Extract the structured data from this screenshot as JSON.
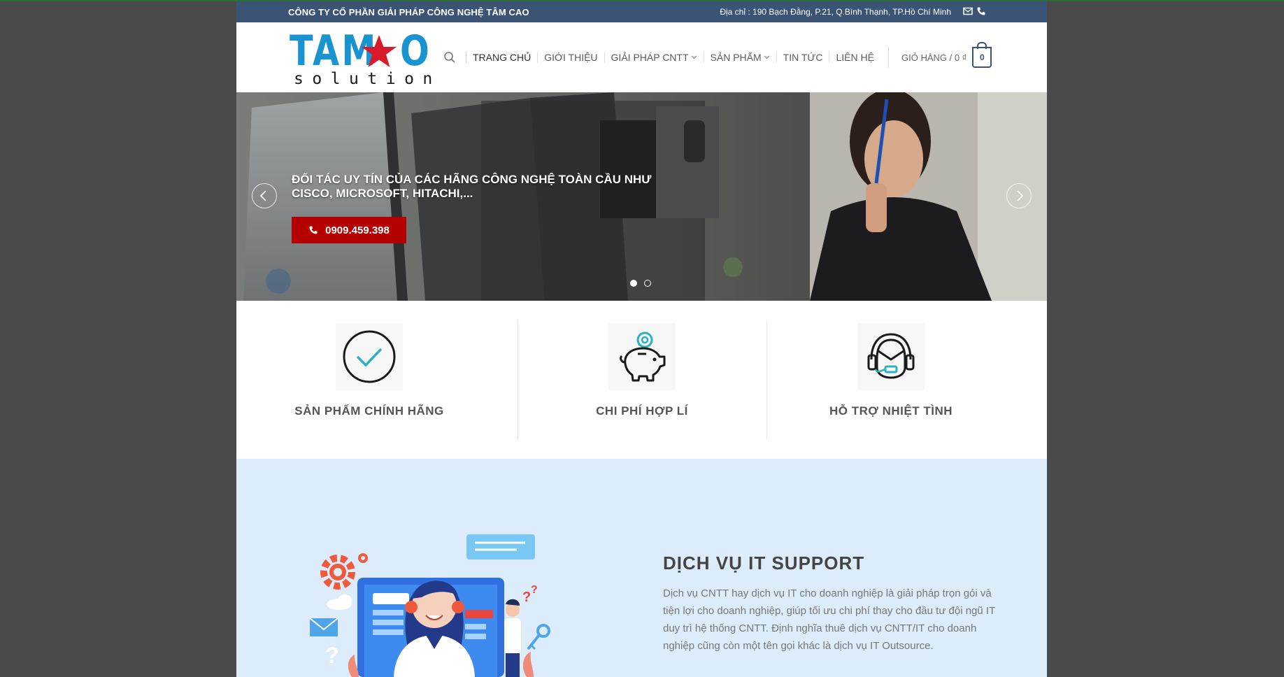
{
  "topbar": {
    "company": "CÔNG TY CỔ PHẦN GIẢI PHÁP CÔNG NGHỆ TÂM CAO",
    "address": "Địa chỉ : 190 Bạch Đằng, P.21, Q.Bình Thạnh, TP.Hồ Chí Minh"
  },
  "logo": {
    "line1_left": "TAM",
    "line1_right": "O",
    "line2": "solution"
  },
  "nav": {
    "items": [
      {
        "label": "TRANG CHỦ"
      },
      {
        "label": "GIỚI THIỆU"
      },
      {
        "label": "GIẢI PHÁP CNTT"
      },
      {
        "label": "SẢN PHẨM"
      },
      {
        "label": "TIN TỨC"
      },
      {
        "label": "LIÊN HỆ"
      }
    ]
  },
  "cart": {
    "label": "GIỎ HÀNG / 0 ₫",
    "count": "0"
  },
  "hero": {
    "headline": "ĐỐI TÁC UY TÍN CỦA CÁC HÃNG CÔNG NGHỆ TOÀN CẦU NHƯ CISCO, MICROSOFT, HITACHI,...",
    "phone": "0909.459.398",
    "active_slide": 1,
    "slide_count": 2
  },
  "features": [
    {
      "title": "SẢN PHẨM CHÍNH HÃNG",
      "icon": "check-circle-icon"
    },
    {
      "title": "CHI PHÍ HỢP LÍ",
      "icon": "piggy-bank-icon"
    },
    {
      "title": "HỖ TRỢ NHIỆT TÌNH",
      "icon": "headset-support-icon"
    }
  ],
  "support": {
    "title": "DỊCH VỤ IT SUPPORT",
    "description": "Dịch vụ CNTT hay dịch vụ IT cho doanh nghiệp là giải pháp trọn gói và tiện lợi cho doanh nghiệp, giúp tối ưu chi phí thay cho đầu tư đội ngũ IT duy trì hệ thống CNTT. Định nghĩa thuê dịch vụ CNTT/IT cho doanh nghiệp cũng còn một tên gọi khác là dịch vụ IT Outsource."
  },
  "colors": {
    "topbar": "#3b5374",
    "brand_blue": "#1a93d1",
    "brand_red": "#d91a2a",
    "cta_red": "#b40000",
    "section_bg": "#dcecfa"
  }
}
